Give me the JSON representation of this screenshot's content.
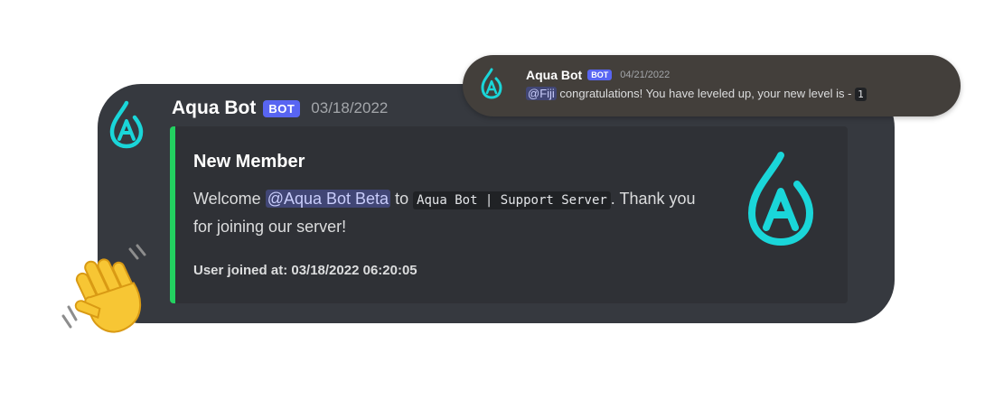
{
  "main_message": {
    "username": "Aqua Bot",
    "bot_tag": "BOT",
    "timestamp": "03/18/2022",
    "embed": {
      "accent_color": "#23d160",
      "title": "New Member",
      "desc_prefix": "Welcome ",
      "mention": "@Aqua Bot Beta",
      "desc_mid": " to ",
      "code": "Aqua Bot | Support Server",
      "desc_suffix": ". Thank you for joining our server!",
      "footer": "User joined at: 03/18/2022 06:20:05"
    }
  },
  "top_message": {
    "username": "Aqua Bot",
    "bot_tag": "BOT",
    "timestamp": "04/21/2022",
    "mention": "@Fiji",
    "text": " congratulations! You have leveled up, your new level is - ",
    "level": "1"
  },
  "colors": {
    "card_bg": "#36393f",
    "top_card_bg": "#433f3b",
    "embed_bg": "#2f3136",
    "bot_tag": "#5865f2",
    "logo_cyan": "#1ad6d9"
  },
  "icons": {
    "avatar": "aqua-bot-logo-icon",
    "thumbnail": "aqua-bot-logo-icon",
    "decoration": "waving-hand-icon"
  }
}
